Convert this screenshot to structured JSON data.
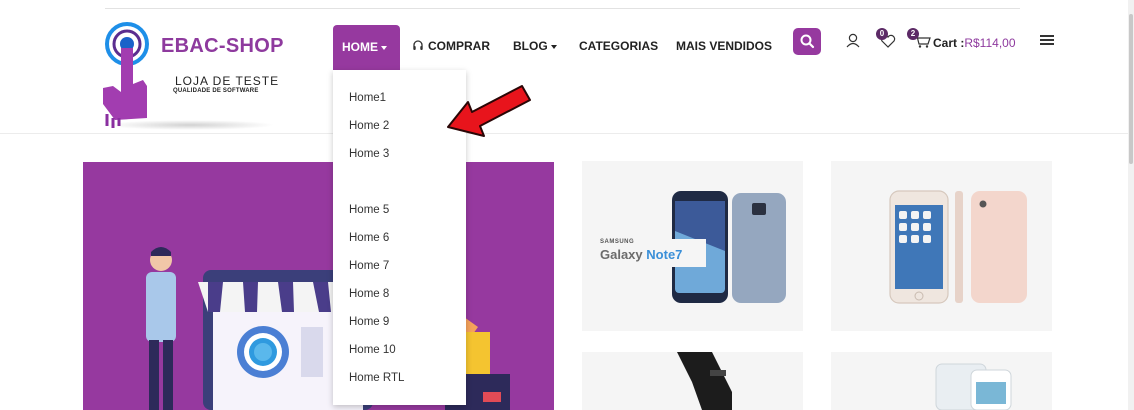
{
  "brand": {
    "name": "EBAC-SHOP",
    "tagline": "LOJA DE TESTE",
    "subtagline": "QUALIDADE DE SOFTWARE"
  },
  "nav": {
    "home": "HOME",
    "comprar": "COMPRAR",
    "blog": "BLOG",
    "categorias": "CATEGORIAS",
    "mais_vendidos": "MAIS VENDIDOS"
  },
  "header": {
    "wishlist_count": "0",
    "cart_count": "2",
    "cart_label": "Cart :",
    "cart_total": "R$114,00"
  },
  "dropdown": {
    "items": [
      "Home1",
      "Home 2",
      "Home 3",
      "Home 5",
      "Home 6",
      "Home 7",
      "Home 8",
      "Home 9",
      "Home 10",
      "Home RTL"
    ]
  },
  "products": {
    "samsung_brand": "SAMSUNG",
    "samsung_model": "Galaxy",
    "samsung_model_suffix": "Note7"
  },
  "colors": {
    "brand_purple": "#96399f",
    "arrow_red": "#e8141c"
  }
}
